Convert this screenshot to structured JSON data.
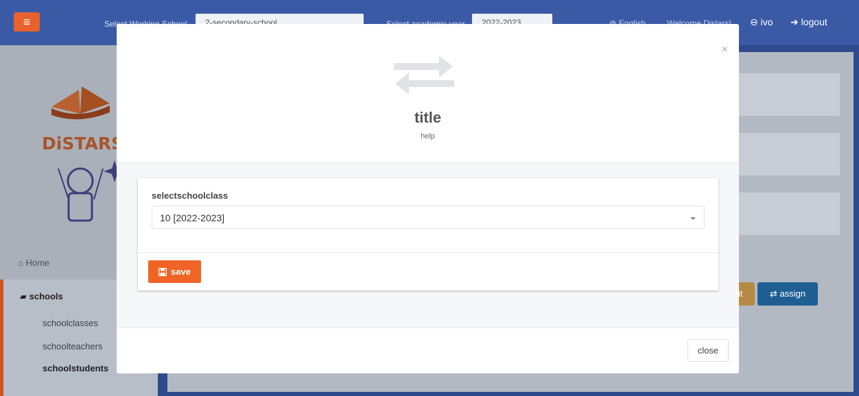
{
  "topbar": {
    "working_school_label": "Select Working School",
    "working_school_value": "2-secondary-school",
    "academic_year_label": "Select academic year",
    "academic_year_value": "2022-2023",
    "language": "English",
    "welcome": "Welcome Distars!",
    "user": "ivo",
    "logout": "logout"
  },
  "sidebar": {
    "brand": "DiSTARS",
    "home": "Home",
    "schools": "schools",
    "sub_items": [
      "schoolclasses",
      "schoolteachers",
      "schoolstudents"
    ]
  },
  "background": {
    "edit_button": "edit",
    "assign_button": "assign"
  },
  "modal": {
    "title": "title",
    "help": "help",
    "field_label": "selectschoolclass",
    "selected_class": "10 [2022-2023]",
    "save_label": "save",
    "close_label": "close",
    "close_x": "×"
  },
  "colors": {
    "accent": "#f06426",
    "primary": "#1f6fb0",
    "topbar": "#3b5aa6"
  }
}
